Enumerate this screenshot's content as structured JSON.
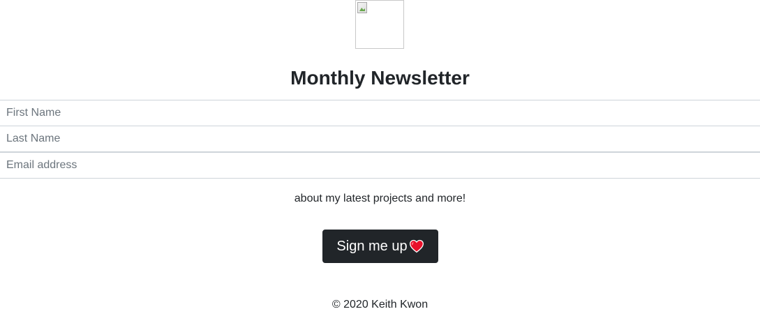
{
  "header": {
    "logo_alt": "",
    "title": "Monthly Newsletter"
  },
  "form": {
    "first_name_placeholder": "First Name",
    "last_name_placeholder": "Last Name",
    "email_placeholder": "Email address",
    "first_name_value": "",
    "last_name_value": "",
    "email_value": ""
  },
  "blurb": "about my latest projects and more!",
  "signup": {
    "label": "Sign me up",
    "icon": "heart-icon",
    "color": "#212529",
    "icon_color": "#e8102a"
  },
  "footer": {
    "copyright": "© 2020 Keith Kwon"
  }
}
